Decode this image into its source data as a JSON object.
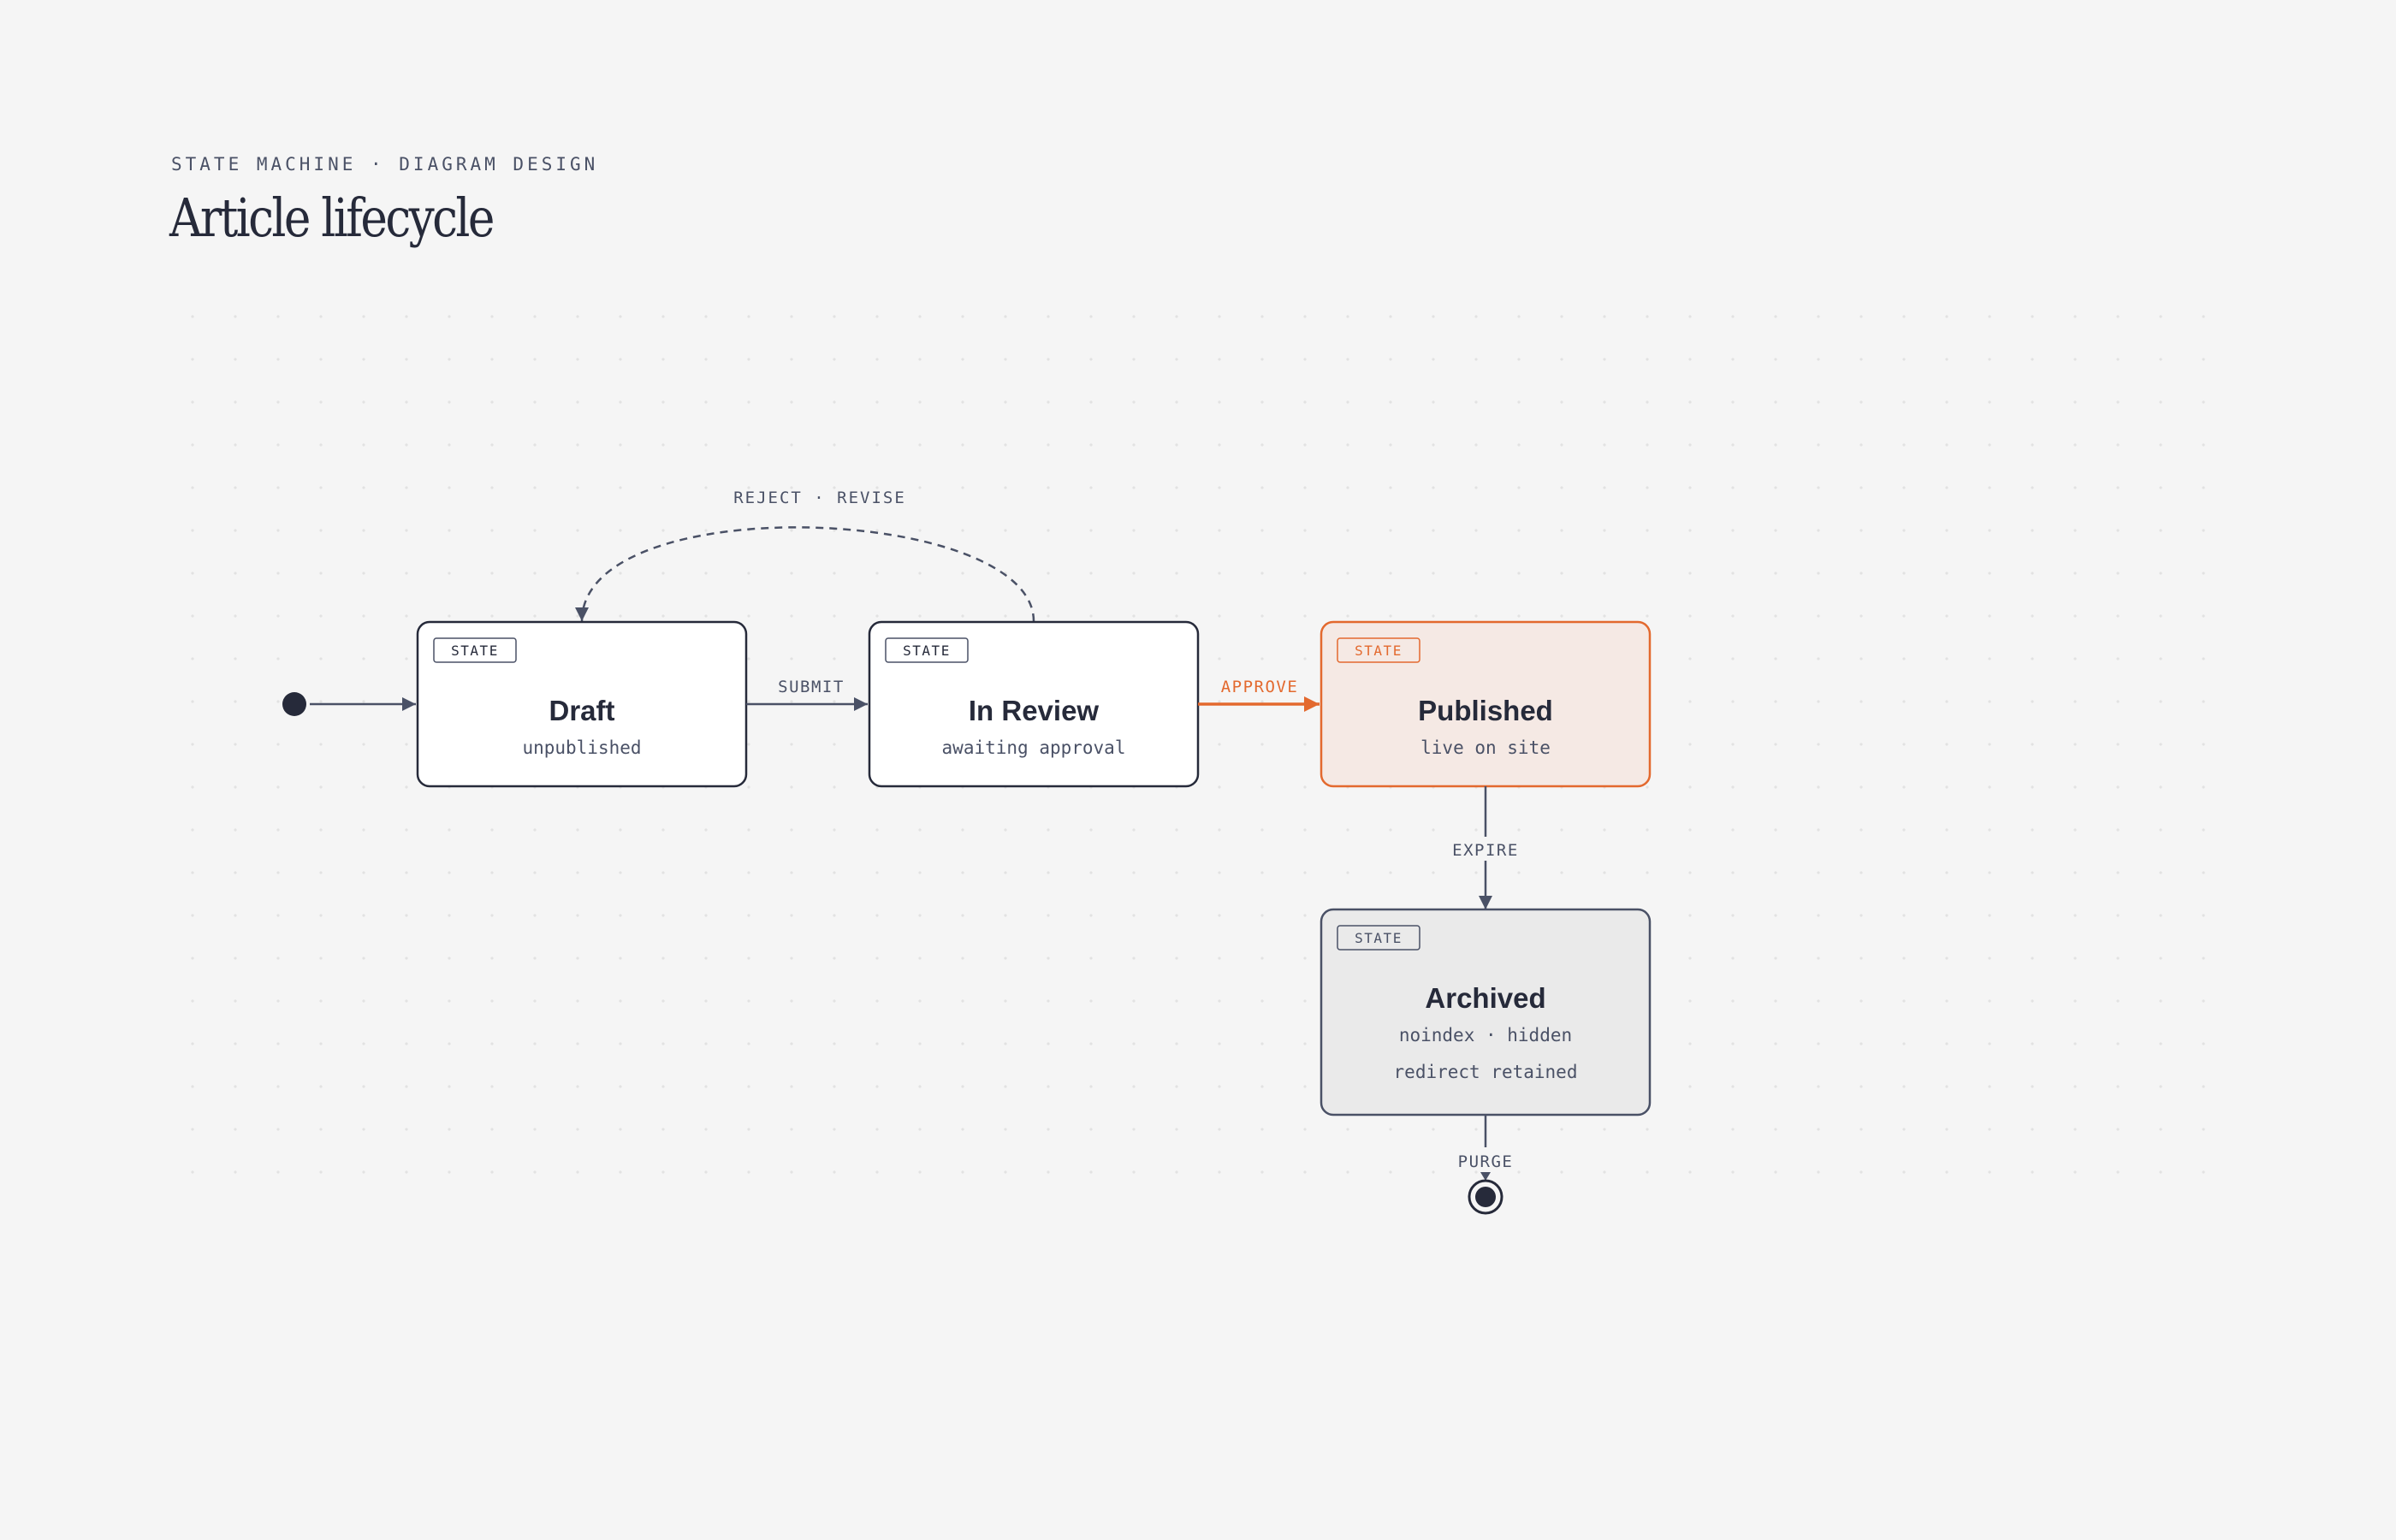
{
  "header": {
    "eyebrow": "STATE MACHINE · DIAGRAM DESIGN",
    "title": "Article lifecycle"
  },
  "colors": {
    "ink": "#262a3a",
    "slate": "#4a5166",
    "accent": "#e3692e",
    "accent_fill": "#f5e9e4",
    "archived_fill": "#eaeaea",
    "background": "#f5f5f5"
  },
  "states": {
    "draft": {
      "tag": "STATE",
      "name": "Draft",
      "desc": "unpublished"
    },
    "review": {
      "tag": "STATE",
      "name": "In Review",
      "desc": "awaiting approval"
    },
    "published": {
      "tag": "STATE",
      "name": "Published",
      "desc": "live on site"
    },
    "archived": {
      "tag": "STATE",
      "name": "Archived",
      "desc": "noindex · hidden",
      "desc2": "redirect retained"
    }
  },
  "transitions": {
    "submit": "SUBMIT",
    "approve": "APPROVE",
    "reject_revise": "REJECT · REVISE",
    "expire": "EXPIRE",
    "purge": "PURGE"
  },
  "icons": {
    "initial": "initial-state-dot",
    "final": "final-state-bullseye"
  }
}
